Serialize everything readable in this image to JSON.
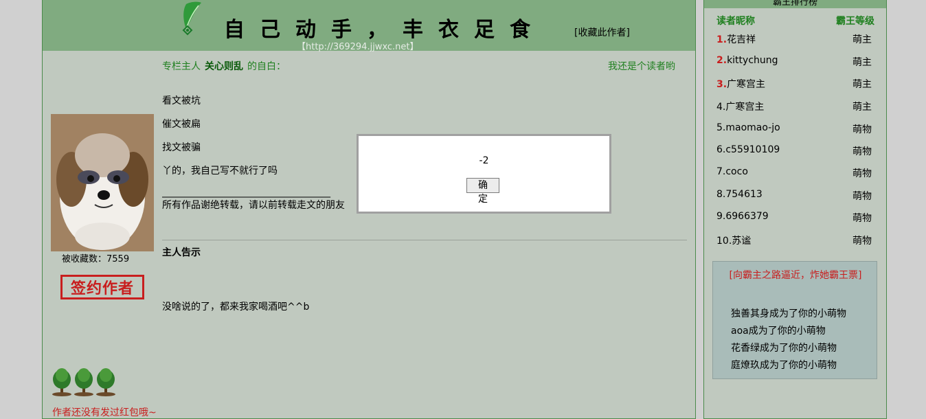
{
  "header": {
    "title": "自己动手，丰衣足食",
    "favorite_author": "[收藏此作者]",
    "url": "【http://369294.jjwxc.net】"
  },
  "intro": {
    "prefix": "专栏主人",
    "author_name": "关心则乱",
    "suffix": "的自白：",
    "reader_link": "我还是个读者哟"
  },
  "bio_lines": [
    "看文被坑",
    "催文被扁",
    "找文被骗",
    "丫的，我自己写不就行了吗",
    "___________________________________",
    "所有作品谢绝转载，请以前转载走文的朋友"
  ],
  "sidebar": {
    "favorite_count": "被收藏数：7559",
    "signed_stamp": "签约作者",
    "red_packet": "作者还没有发过红包哦~"
  },
  "notice": {
    "title": "主人告示",
    "text": "没啥说的了，都来我家喝酒吧^^b"
  },
  "ranking": {
    "header": "霸王排行榜",
    "col_reader": "读者昵称",
    "col_level": "霸王等级",
    "rows": [
      {
        "rank": "1.",
        "name": "花吉祥",
        "level": "萌主",
        "top": true
      },
      {
        "rank": "2.",
        "name": "kittychung",
        "level": "萌主",
        "top": true
      },
      {
        "rank": "3.",
        "name": "广寒宫主",
        "level": "萌主",
        "top": true
      },
      {
        "rank": "4.",
        "name": "广寒宫主",
        "level": "萌主",
        "top": false
      },
      {
        "rank": "5.",
        "name": "maomao-jo",
        "level": "萌物",
        "top": false
      },
      {
        "rank": "6.",
        "name": "c55910109",
        "level": "萌物",
        "top": false
      },
      {
        "rank": "7.",
        "name": "coco",
        "level": "萌物",
        "top": false
      },
      {
        "rank": "8.",
        "name": "754613",
        "level": "萌物",
        "top": false
      },
      {
        "rank": "9.",
        "name": "6966379",
        "level": "萌物",
        "top": false
      },
      {
        "rank": "10.",
        "name": "苏谧",
        "level": "萌物",
        "top": false
      }
    ],
    "vote_link": "[向霸主之路逼近，炸她霸王票]",
    "feed": [
      "独善其身成为了你的小萌物",
      "aoa成为了你的小萌物",
      "花香绿成为了你的小萌物",
      "庭燎玖成为了你的小萌物"
    ]
  },
  "dialog": {
    "message": "-2",
    "ok_label": "确 定"
  },
  "colors": {
    "header_green": "#80ab80",
    "panel_bg": "#c0c9bf",
    "accent_red": "#c81e1e",
    "link_green": "#208020"
  }
}
